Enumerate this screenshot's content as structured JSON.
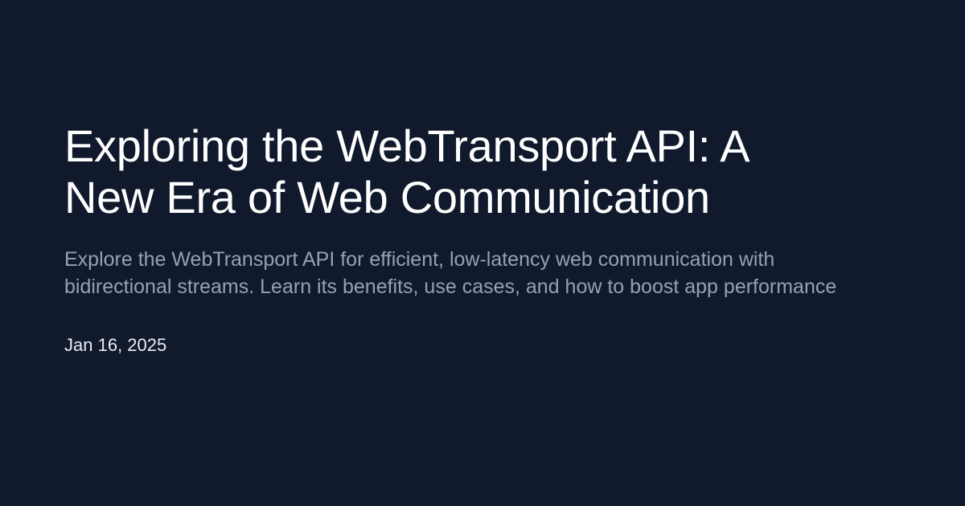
{
  "post": {
    "title": "Exploring the WebTransport API: A New Era of Web Communication",
    "description": "Explore the WebTransport API for efficient, low-latency web communication with bidirectional streams. Learn its benefits, use cases, and how to boost app performance",
    "date": "Jan 16, 2025"
  },
  "colors": {
    "background": "#111a2c",
    "title": "#ffffff",
    "description": "#94a1b5",
    "date": "#e7ebf1"
  }
}
